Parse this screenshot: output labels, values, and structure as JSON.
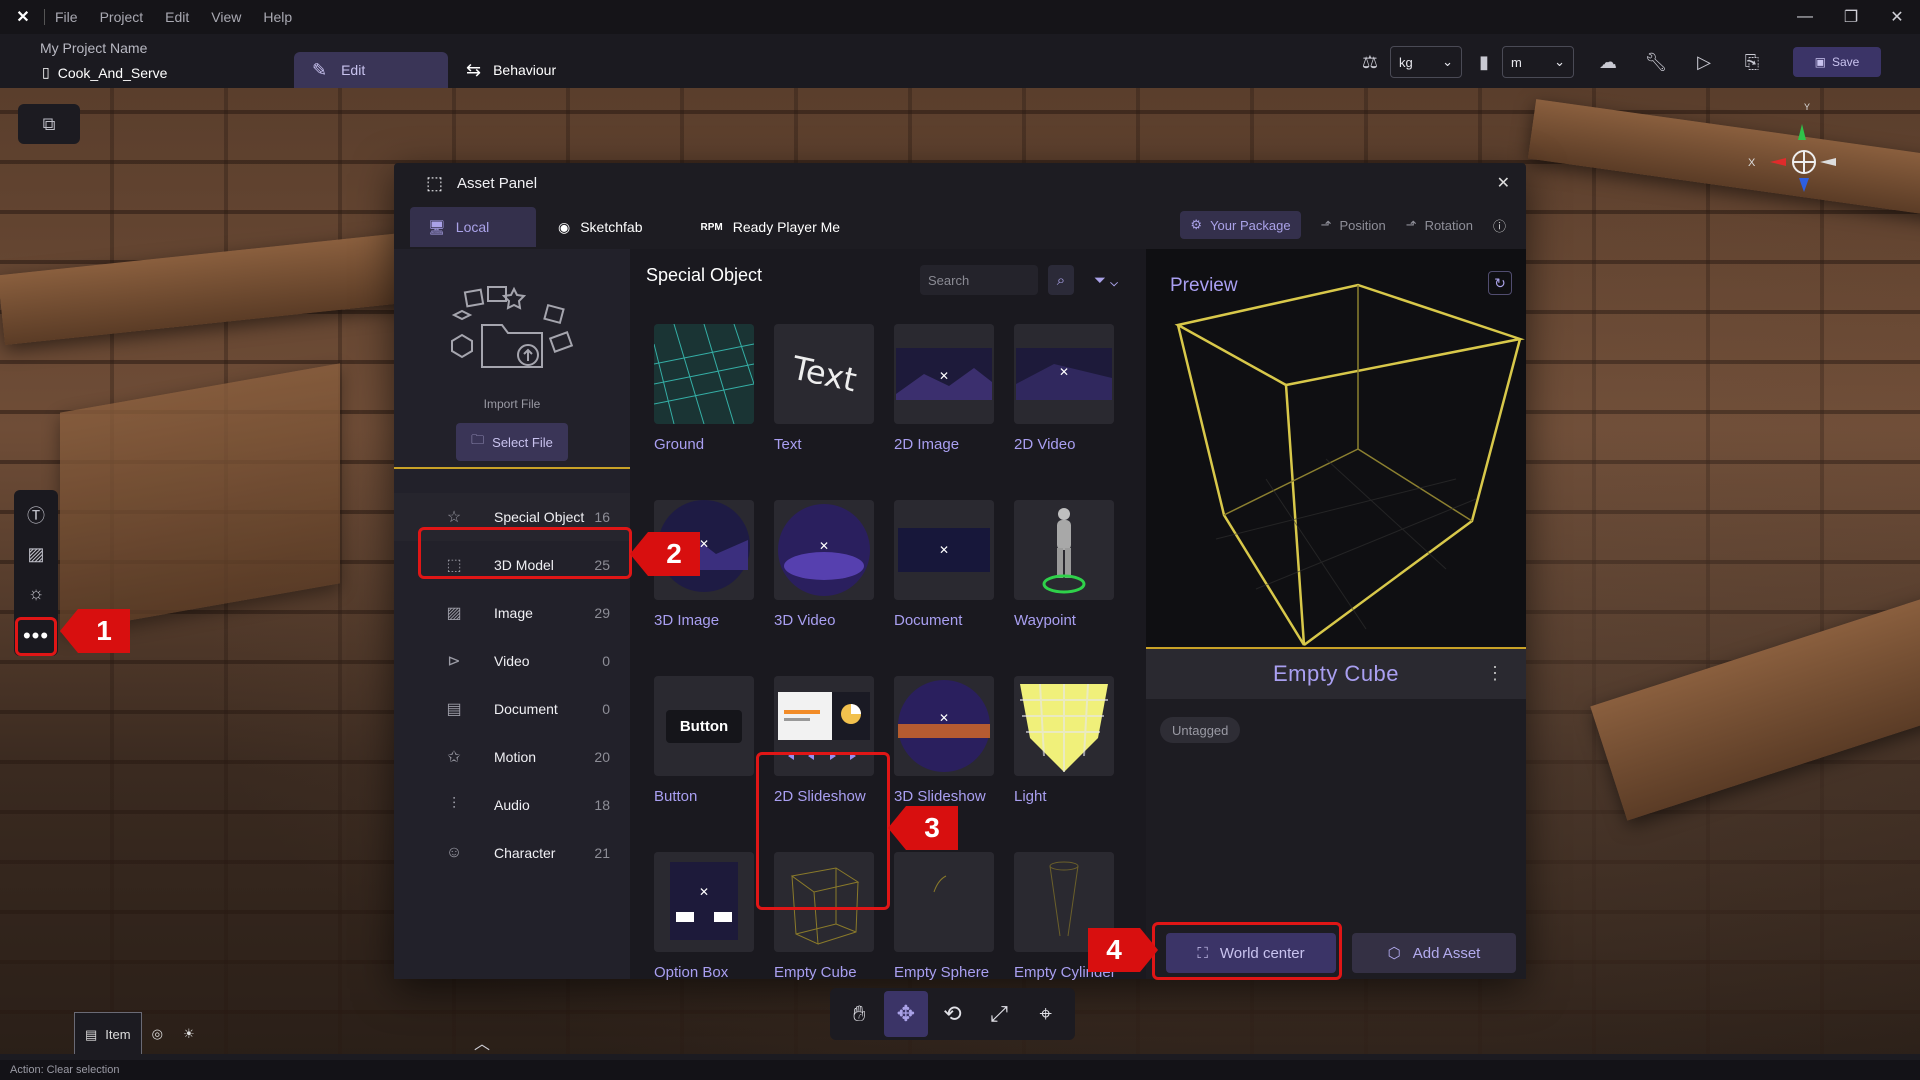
{
  "titlebar": {
    "menu": [
      "File",
      "Project",
      "Edit",
      "View",
      "Help"
    ]
  },
  "project": {
    "name": "My Project Name",
    "scene": "Cook_And_Serve",
    "tab_edit": "Edit",
    "tab_behaviour": "Behaviour",
    "mass_unit": "kg",
    "length_unit": "m",
    "save_label": "Save"
  },
  "gizmo": {
    "x_label": "X",
    "y_label": "Y"
  },
  "asset_panel": {
    "title": "Asset Panel",
    "tabs": [
      "Local",
      "Sketchfab",
      "Ready Player Me"
    ],
    "your_package": "Your Package",
    "position": "Position",
    "rotation": "Rotation",
    "import_label": "Import File",
    "select_file": "Select File",
    "categories": [
      {
        "label": "Special Object",
        "count": "16",
        "icon": "star-icon"
      },
      {
        "label": "3D Model",
        "count": "25",
        "icon": "cube-icon"
      },
      {
        "label": "Image",
        "count": "29",
        "icon": "image-icon"
      },
      {
        "label": "Video",
        "count": "0",
        "icon": "play-circle-icon"
      },
      {
        "label": "Document",
        "count": "0",
        "icon": "document-icon"
      },
      {
        "label": "Motion",
        "count": "20",
        "icon": "motion-icon"
      },
      {
        "label": "Audio",
        "count": "18",
        "icon": "audio-wave-icon"
      },
      {
        "label": "Character",
        "count": "21",
        "icon": "character-icon"
      }
    ],
    "grid_title": "Special Object",
    "search_placeholder": "Search",
    "assets": [
      "Ground",
      "Text",
      "2D Image",
      "2D Video",
      "3D Image",
      "3D Video",
      "Document",
      "Waypoint",
      "Button",
      "2D Slideshow",
      "3D Slideshow",
      "Light",
      "Option Box",
      "Empty Cube",
      "Empty Sphere",
      "Empty Cylinder"
    ],
    "thumb_text": "Text",
    "thumb_button": "Button",
    "preview": {
      "title": "Preview",
      "name": "Empty Cube",
      "tag": "Untagged",
      "world_center": "World center",
      "add_asset": "Add Asset"
    }
  },
  "annotations": [
    "1",
    "2",
    "3",
    "4"
  ],
  "bottom": {
    "item_tab": "Item",
    "status": "Action: Clear selection"
  },
  "colors": {
    "accent": "#a99ff1",
    "highlight_red": "#e01616",
    "divider_gold": "#c9a227"
  }
}
